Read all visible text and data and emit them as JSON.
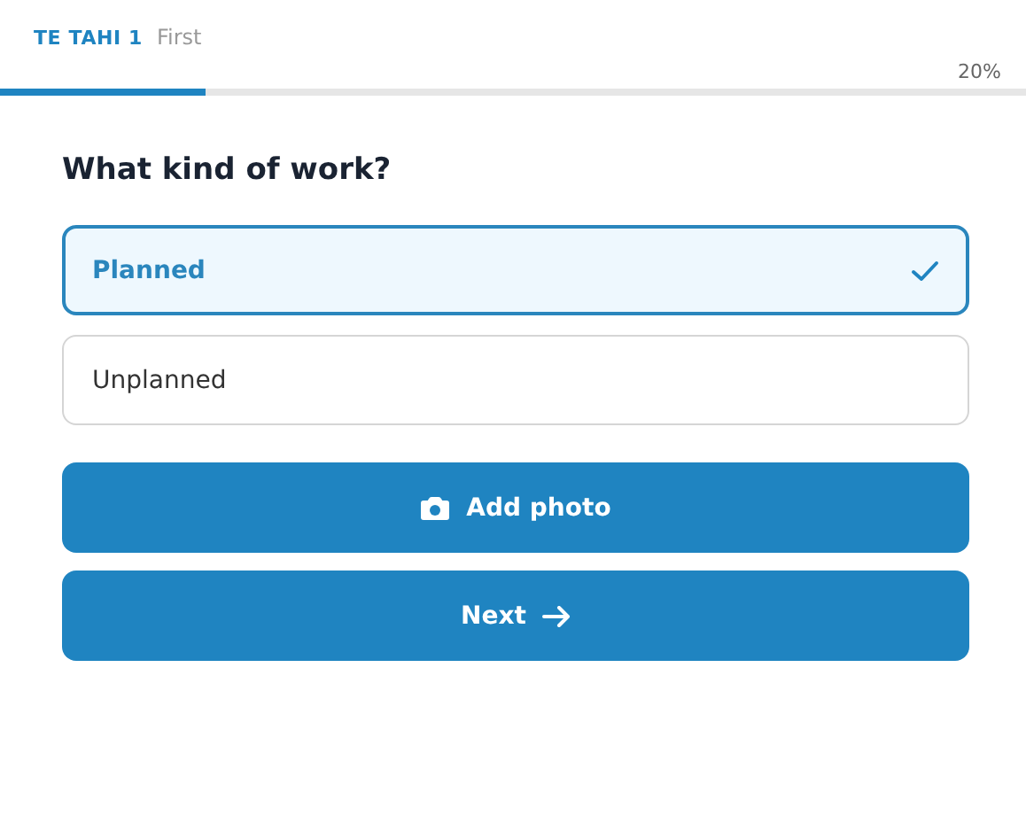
{
  "header": {
    "step": "TE TAHI 1",
    "step_name": "First",
    "progress_text": "20%",
    "level": 0.2
  },
  "question": "What kind of work?",
  "options": [
    {
      "label": "Planned",
      "selected": true
    },
    {
      "label": "Unplanned",
      "selected": false
    }
  ],
  "buttons": [
    {
      "label": "Add photo",
      "kind": "photo"
    },
    {
      "label": "Next",
      "kind": "next"
    }
  ]
}
